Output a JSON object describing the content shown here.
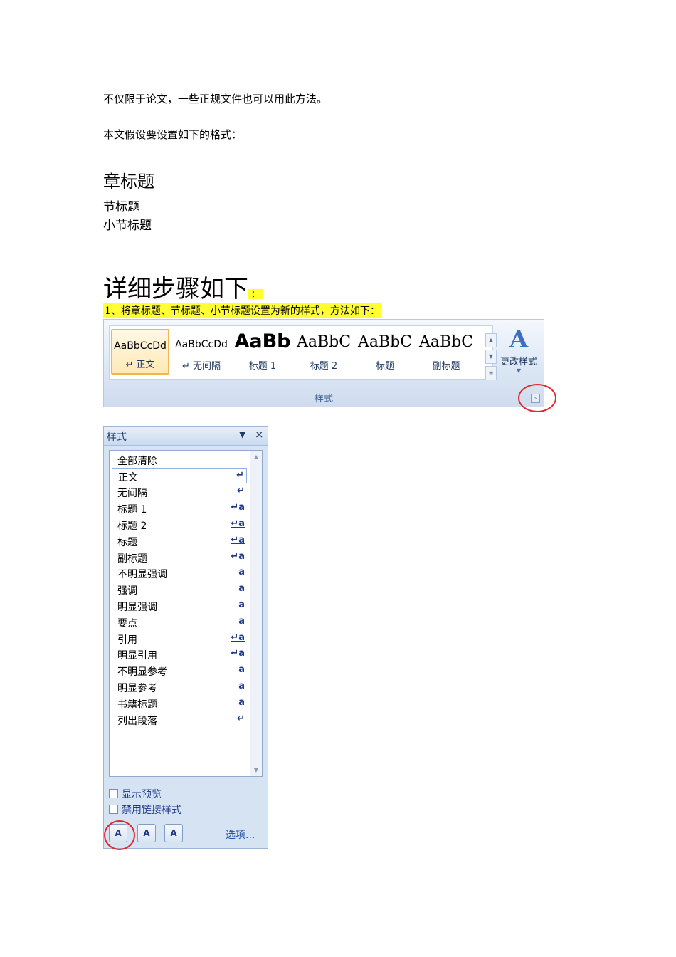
{
  "doc": {
    "line1": "不仅限于论文，一些正规文件也可以用此方法。",
    "line2": "本文假设要设置如下的格式：",
    "chapter_heading": "章标题",
    "section_heading": "节标题",
    "subsection_heading": "小节标题",
    "steps_heading": "详细步骤如下",
    "steps_heading_mark": "：",
    "step1": "1、将章标题、节标题、小节标题设置为新的样式，方法如下："
  },
  "ribbon": {
    "tiles": [
      {
        "sample": "AaBbCcDd",
        "name": "↵ 正文"
      },
      {
        "sample": "AaBbCcDd",
        "name": "↵ 无间隔"
      },
      {
        "sample": "AaBb",
        "name": "标题 1"
      },
      {
        "sample": "AaBbC",
        "name": "标题 2"
      },
      {
        "sample": "AaBbC",
        "name": "标题"
      },
      {
        "sample": "AaBbC",
        "name": "副标题"
      }
    ],
    "change_styles_label": "更改样式",
    "group_label": "样式"
  },
  "styles_pane": {
    "title": "样式",
    "items": [
      {
        "label": "全部清除",
        "icon": ""
      },
      {
        "label": "正文",
        "icon": "↵"
      },
      {
        "label": "无间隔",
        "icon": "↵"
      },
      {
        "label": "标题 1",
        "icon": "↵a"
      },
      {
        "label": "标题 2",
        "icon": "↵a"
      },
      {
        "label": "标题",
        "icon": "↵a"
      },
      {
        "label": "副标题",
        "icon": "↵a"
      },
      {
        "label": "不明显强调",
        "icon": "a"
      },
      {
        "label": "强调",
        "icon": "a"
      },
      {
        "label": "明显强调",
        "icon": "a"
      },
      {
        "label": "要点",
        "icon": "a"
      },
      {
        "label": "引用",
        "icon": "↵a"
      },
      {
        "label": "明显引用",
        "icon": "↵a"
      },
      {
        "label": "不明显参考",
        "icon": "a"
      },
      {
        "label": "明显参考",
        "icon": "a"
      },
      {
        "label": "书籍标题",
        "icon": "a"
      },
      {
        "label": "列出段落",
        "icon": "↵"
      }
    ],
    "show_preview_label": "显示预览",
    "disable_linked_label": "禁用链接样式",
    "options_label": "选项..."
  }
}
